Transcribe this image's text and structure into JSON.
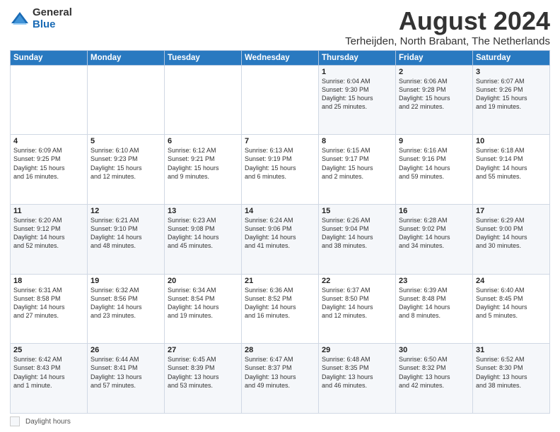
{
  "logo": {
    "general": "General",
    "blue": "Blue"
  },
  "title": "August 2024",
  "subtitle": "Terheijden, North Brabant, The Netherlands",
  "days_of_week": [
    "Sunday",
    "Monday",
    "Tuesday",
    "Wednesday",
    "Thursday",
    "Friday",
    "Saturday"
  ],
  "footer_label": "Daylight hours",
  "weeks": [
    [
      {
        "day": "",
        "info": ""
      },
      {
        "day": "",
        "info": ""
      },
      {
        "day": "",
        "info": ""
      },
      {
        "day": "",
        "info": ""
      },
      {
        "day": "1",
        "info": "Sunrise: 6:04 AM\nSunset: 9:30 PM\nDaylight: 15 hours\nand 25 minutes."
      },
      {
        "day": "2",
        "info": "Sunrise: 6:06 AM\nSunset: 9:28 PM\nDaylight: 15 hours\nand 22 minutes."
      },
      {
        "day": "3",
        "info": "Sunrise: 6:07 AM\nSunset: 9:26 PM\nDaylight: 15 hours\nand 19 minutes."
      }
    ],
    [
      {
        "day": "4",
        "info": "Sunrise: 6:09 AM\nSunset: 9:25 PM\nDaylight: 15 hours\nand 16 minutes."
      },
      {
        "day": "5",
        "info": "Sunrise: 6:10 AM\nSunset: 9:23 PM\nDaylight: 15 hours\nand 12 minutes."
      },
      {
        "day": "6",
        "info": "Sunrise: 6:12 AM\nSunset: 9:21 PM\nDaylight: 15 hours\nand 9 minutes."
      },
      {
        "day": "7",
        "info": "Sunrise: 6:13 AM\nSunset: 9:19 PM\nDaylight: 15 hours\nand 6 minutes."
      },
      {
        "day": "8",
        "info": "Sunrise: 6:15 AM\nSunset: 9:17 PM\nDaylight: 15 hours\nand 2 minutes."
      },
      {
        "day": "9",
        "info": "Sunrise: 6:16 AM\nSunset: 9:16 PM\nDaylight: 14 hours\nand 59 minutes."
      },
      {
        "day": "10",
        "info": "Sunrise: 6:18 AM\nSunset: 9:14 PM\nDaylight: 14 hours\nand 55 minutes."
      }
    ],
    [
      {
        "day": "11",
        "info": "Sunrise: 6:20 AM\nSunset: 9:12 PM\nDaylight: 14 hours\nand 52 minutes."
      },
      {
        "day": "12",
        "info": "Sunrise: 6:21 AM\nSunset: 9:10 PM\nDaylight: 14 hours\nand 48 minutes."
      },
      {
        "day": "13",
        "info": "Sunrise: 6:23 AM\nSunset: 9:08 PM\nDaylight: 14 hours\nand 45 minutes."
      },
      {
        "day": "14",
        "info": "Sunrise: 6:24 AM\nSunset: 9:06 PM\nDaylight: 14 hours\nand 41 minutes."
      },
      {
        "day": "15",
        "info": "Sunrise: 6:26 AM\nSunset: 9:04 PM\nDaylight: 14 hours\nand 38 minutes."
      },
      {
        "day": "16",
        "info": "Sunrise: 6:28 AM\nSunset: 9:02 PM\nDaylight: 14 hours\nand 34 minutes."
      },
      {
        "day": "17",
        "info": "Sunrise: 6:29 AM\nSunset: 9:00 PM\nDaylight: 14 hours\nand 30 minutes."
      }
    ],
    [
      {
        "day": "18",
        "info": "Sunrise: 6:31 AM\nSunset: 8:58 PM\nDaylight: 14 hours\nand 27 minutes."
      },
      {
        "day": "19",
        "info": "Sunrise: 6:32 AM\nSunset: 8:56 PM\nDaylight: 14 hours\nand 23 minutes."
      },
      {
        "day": "20",
        "info": "Sunrise: 6:34 AM\nSunset: 8:54 PM\nDaylight: 14 hours\nand 19 minutes."
      },
      {
        "day": "21",
        "info": "Sunrise: 6:36 AM\nSunset: 8:52 PM\nDaylight: 14 hours\nand 16 minutes."
      },
      {
        "day": "22",
        "info": "Sunrise: 6:37 AM\nSunset: 8:50 PM\nDaylight: 14 hours\nand 12 minutes."
      },
      {
        "day": "23",
        "info": "Sunrise: 6:39 AM\nSunset: 8:48 PM\nDaylight: 14 hours\nand 8 minutes."
      },
      {
        "day": "24",
        "info": "Sunrise: 6:40 AM\nSunset: 8:45 PM\nDaylight: 14 hours\nand 5 minutes."
      }
    ],
    [
      {
        "day": "25",
        "info": "Sunrise: 6:42 AM\nSunset: 8:43 PM\nDaylight: 14 hours\nand 1 minute."
      },
      {
        "day": "26",
        "info": "Sunrise: 6:44 AM\nSunset: 8:41 PM\nDaylight: 13 hours\nand 57 minutes."
      },
      {
        "day": "27",
        "info": "Sunrise: 6:45 AM\nSunset: 8:39 PM\nDaylight: 13 hours\nand 53 minutes."
      },
      {
        "day": "28",
        "info": "Sunrise: 6:47 AM\nSunset: 8:37 PM\nDaylight: 13 hours\nand 49 minutes."
      },
      {
        "day": "29",
        "info": "Sunrise: 6:48 AM\nSunset: 8:35 PM\nDaylight: 13 hours\nand 46 minutes."
      },
      {
        "day": "30",
        "info": "Sunrise: 6:50 AM\nSunset: 8:32 PM\nDaylight: 13 hours\nand 42 minutes."
      },
      {
        "day": "31",
        "info": "Sunrise: 6:52 AM\nSunset: 8:30 PM\nDaylight: 13 hours\nand 38 minutes."
      }
    ]
  ]
}
